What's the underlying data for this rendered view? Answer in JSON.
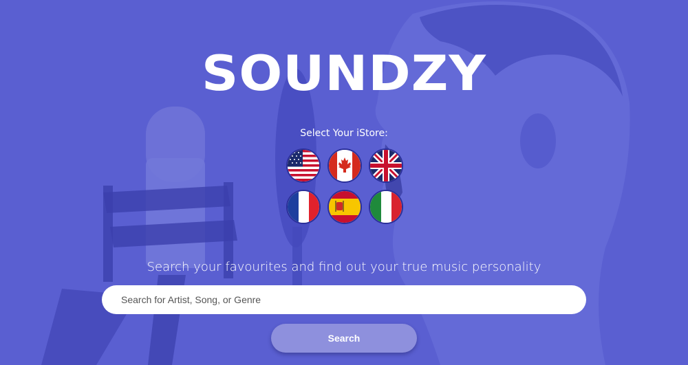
{
  "brand": {
    "logo_text": "SOUNDZY"
  },
  "store_selector": {
    "label": "Select Your iStore:",
    "flags": [
      {
        "country": "United States",
        "icon": "us-flag-icon"
      },
      {
        "country": "Canada",
        "icon": "canada-flag-icon"
      },
      {
        "country": "United Kingdom",
        "icon": "uk-flag-icon"
      },
      {
        "country": "France",
        "icon": "france-flag-icon"
      },
      {
        "country": "Spain",
        "icon": "spain-flag-icon"
      },
      {
        "country": "Italy",
        "icon": "italy-flag-icon"
      }
    ]
  },
  "tagline": "Search your favourites and find out your true music personality",
  "search": {
    "placeholder": "Search for Artist, Song, or Genre",
    "value": "",
    "button_label": "Search"
  },
  "colors": {
    "background_tint": "#5a5fd0",
    "button": "#8e90dd",
    "text": "#ffffff"
  }
}
